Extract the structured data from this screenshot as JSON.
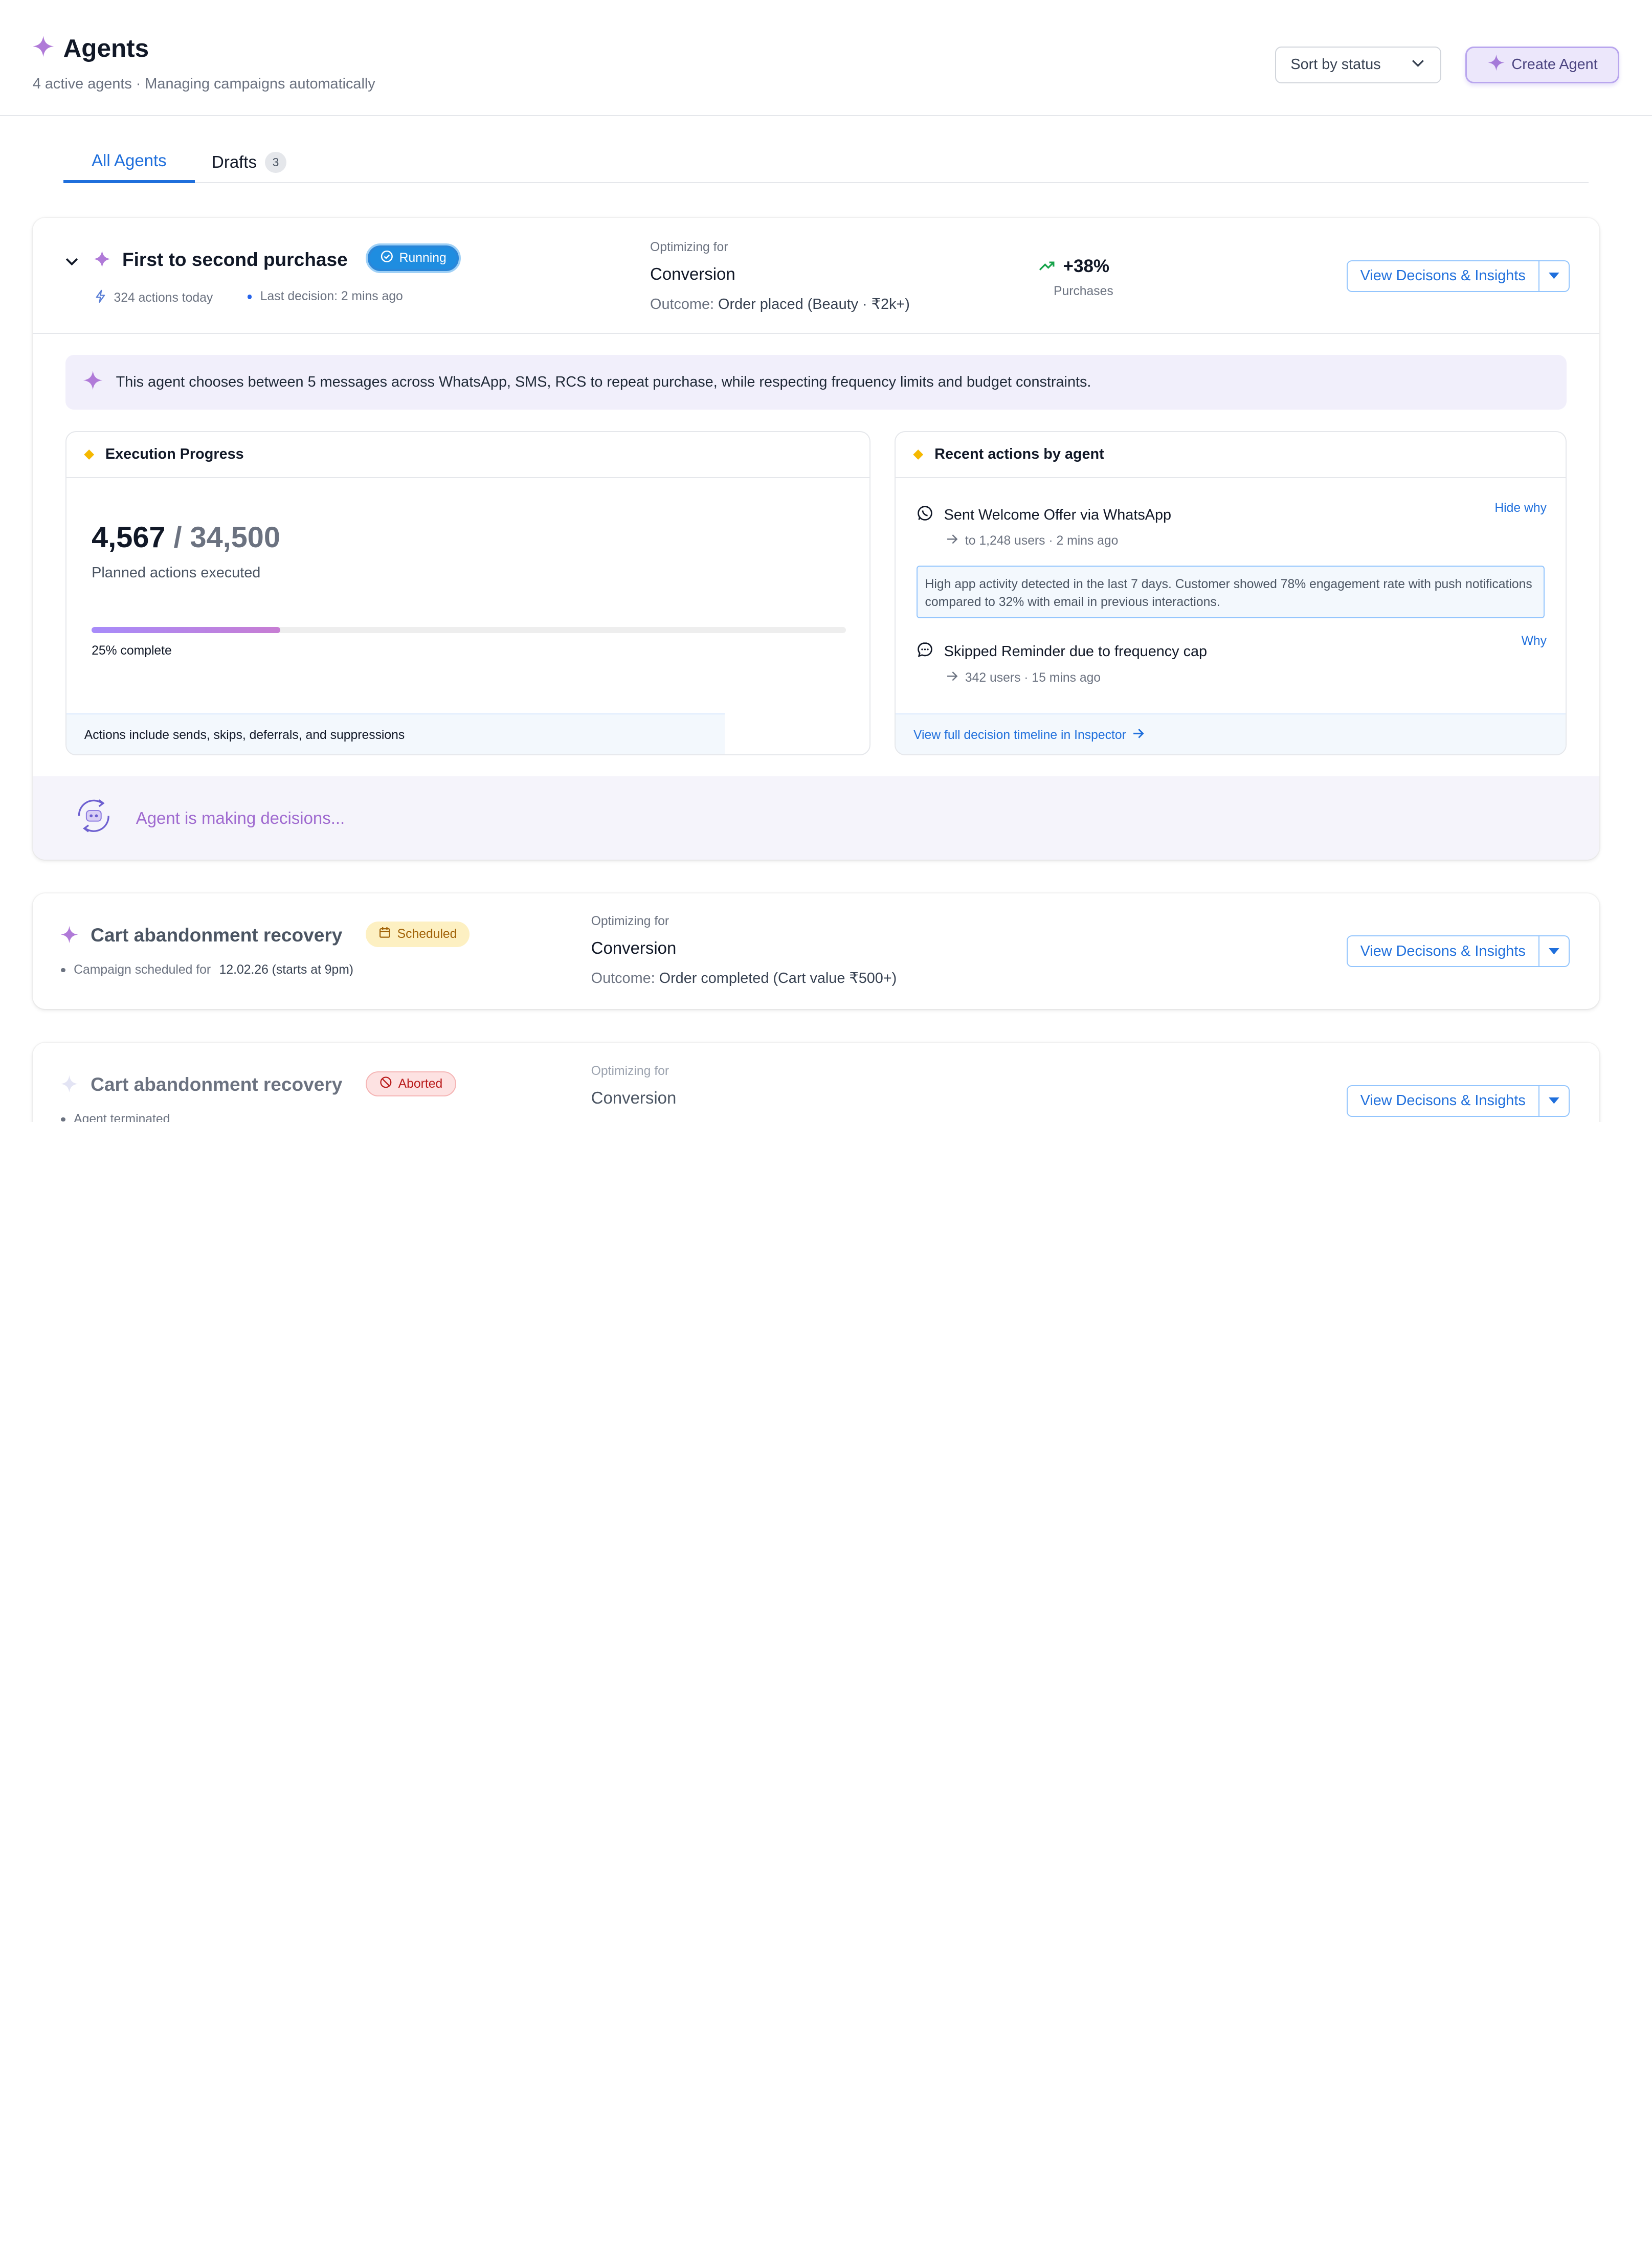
{
  "header": {
    "title": "Agents",
    "subtitle": "4 active agents · Managing campaigns automatically",
    "sort_label": "Sort by status",
    "create_label": "Create Agent"
  },
  "tabs": [
    {
      "label": "All Agents",
      "active": true
    },
    {
      "label": "Drafts",
      "count": "3",
      "active": false
    }
  ],
  "colors": {
    "accent": "#1f6fdc",
    "purple": "#a78bfa",
    "running": "#1f8de0",
    "scheduled_bg": "#fdf0c2",
    "aborted_bg": "#fde2e2"
  },
  "agents": [
    {
      "name": "First to second purchase",
      "status": "Running",
      "actions_today": "324 actions today",
      "last_decision": "Last decision: 2 mins ago",
      "optimizing_label": "Optimizing for",
      "optimizing_value": "Conversion",
      "outcome_prefix": "Outcome:",
      "outcome_value": "Order placed (Beauty · ₹2k+)",
      "metric_value": "+38%",
      "metric_label": "Purchases",
      "view_label": "View Decisons & Insights",
      "description": "This agent chooses between 5 messages across WhatsApp, SMS, RCS to repeat purchase, while respecting frequency limits and budget constraints.",
      "execution": {
        "title": "Execution Progress",
        "executed": "4,567",
        "total": "/ 34,500",
        "executed_label": "Planned actions executed",
        "progress": 0.25,
        "progress_label": "25% complete",
        "footnote": "Actions include sends, skips, deferrals, and suppressions"
      },
      "recent": {
        "title": "Recent actions by agent",
        "items": [
          {
            "icon": "whatsapp-icon",
            "title": "Sent Welcome Offer via WhatsApp",
            "sub": "to 1,248 users · 2 mins ago",
            "link": "Hide why",
            "why": "High app activity detected in the last 7 days. Customer showed 78% engagement rate with push notifications compared to 32% with email in previous interactions."
          },
          {
            "icon": "chat-icon",
            "title": "Skipped Reminder due to frequency cap",
            "sub": "342 users · 15 mins ago",
            "link": "Why"
          }
        ],
        "footer_link": "View full decision timeline in Inspector"
      },
      "deciding_text": "Agent is making decisions..."
    },
    {
      "name": "Cart abandonment recovery",
      "status": "Scheduled",
      "meta_prefix": "Campaign scheduled for",
      "meta_value": "12.02.26 (starts at 9pm)",
      "optimizing_label": "Optimizing for",
      "optimizing_value": "Conversion",
      "outcome_prefix": "Outcome:",
      "outcome_value": "Order completed (Cart value ₹500+)",
      "view_label": "View Decisons & Insights"
    },
    {
      "name": "Cart abandonment recovery",
      "status": "Aborted",
      "meta": "Agent terminated",
      "optimizing_label": "Optimizing for",
      "optimizing_value": "Conversion",
      "view_label": "View Decisons & Insights"
    }
  ]
}
